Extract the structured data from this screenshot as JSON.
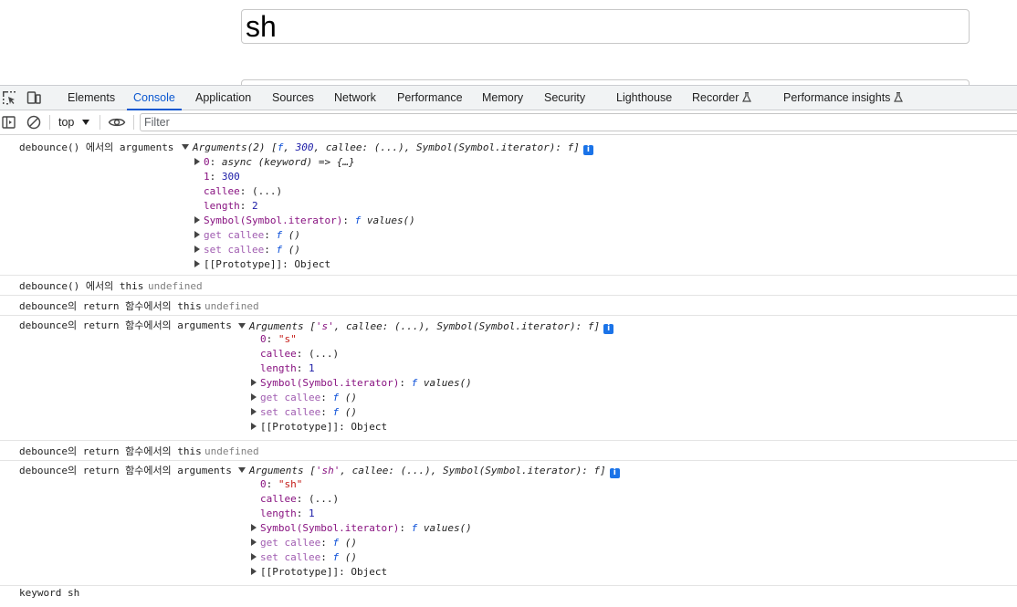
{
  "page": {
    "search_value": "sh"
  },
  "devtools": {
    "tabs": [
      "Elements",
      "Console",
      "Application",
      "Sources",
      "Network",
      "Performance",
      "Memory",
      "Security",
      "Lighthouse",
      "Recorder",
      "Performance insights"
    ],
    "active_tab": "Console",
    "toolbar": {
      "context": "top",
      "filter_placeholder": "Filter"
    }
  },
  "console": {
    "m1": {
      "label": "debounce() 에서의 arguments",
      "summary": {
        "head": "Arguments(2) [",
        "f": "f",
        "sep1": ", ",
        "n300": "300",
        "rest": ", callee: (...), Symbol(Symbol.iterator): f]"
      },
      "rows": {
        "k0": "0",
        "v0": "async (keyword) => {…}",
        "k1": "1",
        "v1": "300",
        "kcallee": "callee",
        "vcallee": "(...)",
        "klength": "length",
        "vlength": "2",
        "ksym": "Symbol(Symbol.iterator)",
        "vsym_f": "f",
        "vsym": " values()",
        "kget": "get callee",
        "vget_f": "f",
        "vget": " ()",
        "kset": "set callee",
        "vset_f": "f",
        "vset": " ()",
        "kproto": "[[Prototype]]",
        "vproto": "Object"
      }
    },
    "m2": {
      "label": "debounce() 에서의 this",
      "value": "undefined"
    },
    "m3": {
      "label": "debounce의 return 함수에서의 this",
      "value": "undefined"
    },
    "m4": {
      "label": "debounce의 return 함수에서의 arguments",
      "summary": {
        "head": "Arguments [",
        "s": "'s'",
        "rest": ", callee: (...), Symbol(Symbol.iterator): f]"
      },
      "rows": {
        "k0": "0",
        "v0": "\"s\"",
        "kcallee": "callee",
        "vcallee": "(...)",
        "klength": "length",
        "vlength": "1",
        "ksym": "Symbol(Symbol.iterator)",
        "vsym_f": "f",
        "vsym": " values()",
        "kget": "get callee",
        "vget_f": "f",
        "vget": " ()",
        "kset": "set callee",
        "vset_f": "f",
        "vset": " ()",
        "kproto": "[[Prototype]]",
        "vproto": "Object"
      }
    },
    "m5": {
      "label": "debounce의 return 함수에서의 this",
      "value": "undefined"
    },
    "m6": {
      "label": "debounce의 return 함수에서의 arguments",
      "summary": {
        "head": "Arguments [",
        "s": "'sh'",
        "rest": ", callee: (...), Symbol(Symbol.iterator): f]"
      },
      "rows": {
        "k0": "0",
        "v0": "\"sh\"",
        "kcallee": "callee",
        "vcallee": "(...)",
        "klength": "length",
        "vlength": "1",
        "ksym": "Symbol(Symbol.iterator)",
        "vsym_f": "f",
        "vsym": " values()",
        "kget": "get callee",
        "vget_f": "f",
        "vget": " ()",
        "kset": "set callee",
        "vset_f": "f",
        "vset": " ()",
        "kproto": "[[Prototype]]",
        "vproto": "Object"
      }
    },
    "m7": {
      "label": "keyword",
      "value": "sh"
    }
  }
}
